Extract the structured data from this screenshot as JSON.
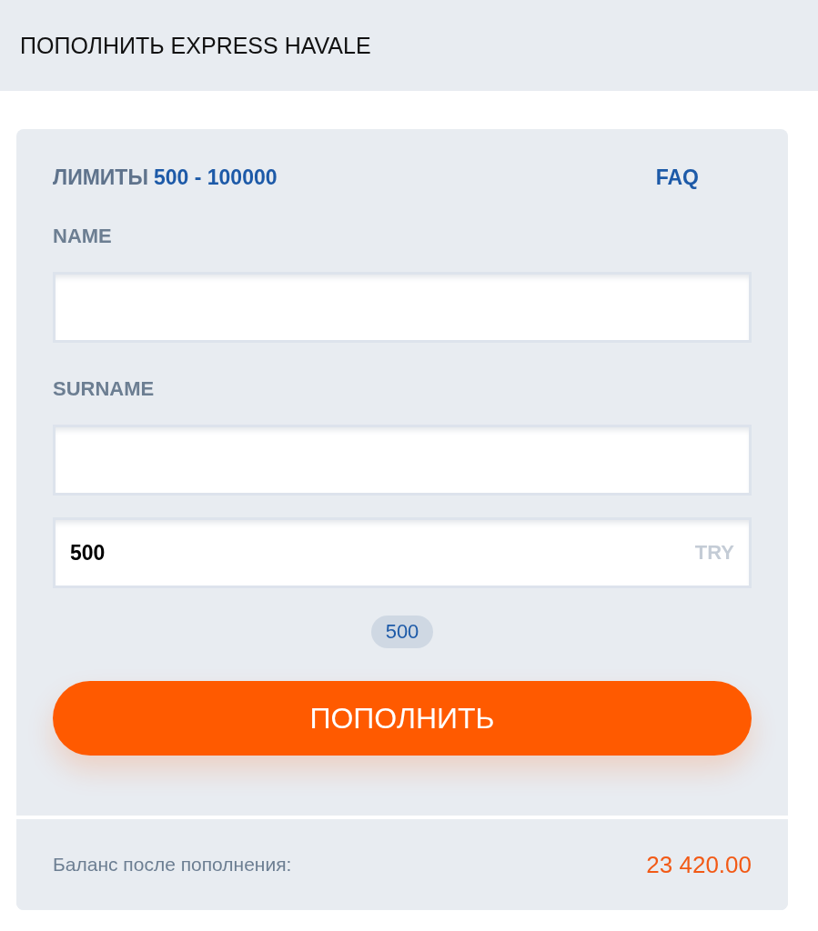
{
  "header": {
    "title": "ПОПОЛНИТЬ EXPRESS HAVALE"
  },
  "limits": {
    "label": "ЛИМИТЫ",
    "range": "500 - 100000"
  },
  "faq_link": "FAQ",
  "fields": [
    {
      "label": "NAME"
    },
    {
      "label": "SURNAME"
    }
  ],
  "amount": {
    "value": "500",
    "currency": "TRY"
  },
  "presets": [
    "500"
  ],
  "submit_button": "ПОПОЛНИТЬ",
  "balance": {
    "label": "Баланс после пополнения:",
    "value": "23 420.00"
  }
}
